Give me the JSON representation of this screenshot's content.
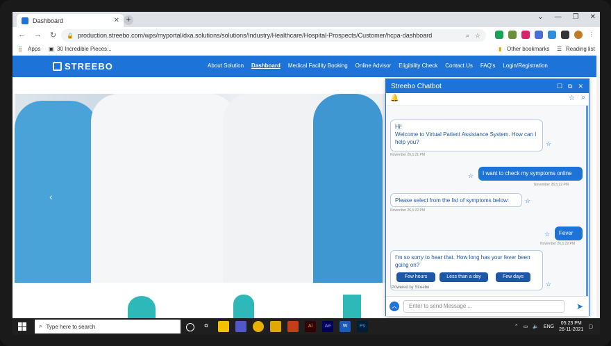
{
  "browser": {
    "tab_title": "Dashboard",
    "url": "production.streebo.com/wps/myportal/dxa.solutions/solutions/Industry/Healthcare/Hospital-Prospects/Customer/hcpa-dashboard",
    "bookmarks": {
      "apps": "Apps",
      "item1": "30 Incredible Pieces...",
      "other": "Other bookmarks",
      "reading": "Reading list"
    }
  },
  "site": {
    "logo": "STREEBO",
    "menu": [
      "About Solution",
      "Dashboard",
      "Medical Facility Booking",
      "Online Advisor",
      "Eligibility Check",
      "Contact Us",
      "FAQ's",
      "Login/Registration"
    ]
  },
  "chatbot": {
    "title": "Streebo Chatbot",
    "messages": [
      {
        "from": "bot",
        "text": "Hi!\nWelcome to Virtual Patient Assistance System. How can I help you?",
        "time": "November 26,5:21 PM"
      },
      {
        "from": "user",
        "text": "I want to check my symptoms online",
        "time": "November 26,5:22 PM"
      },
      {
        "from": "bot",
        "text": "Please select from the list of symptoms below:",
        "time": "November 26,5:22 PM"
      },
      {
        "from": "user",
        "text": "Fever",
        "time": "November 26,5:22 PM"
      },
      {
        "from": "bot",
        "text": "I'm so sorry to hear that. How long has your fever been going on?",
        "time": ""
      }
    ],
    "options": [
      "Few hours",
      "Less than a day",
      "Few days"
    ],
    "powered": "Powered by Streebo",
    "input_placeholder": "Enter to send Message ..."
  },
  "taskbar": {
    "search_placeholder": "Type here to search",
    "lang": "ENG",
    "time": "05:23 PM",
    "date": "26-11-2021"
  }
}
